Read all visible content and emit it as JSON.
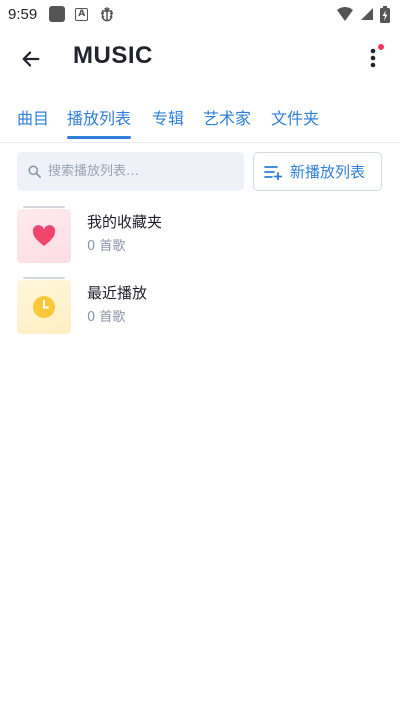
{
  "status_bar": {
    "time": "9:59",
    "icons": [
      "app-square-icon",
      "a-box-icon",
      "bug-icon",
      "wifi-icon",
      "signal-icon",
      "battery-charging-icon"
    ]
  },
  "app_bar": {
    "title": "MUSIC",
    "back_icon": "arrow-left-icon",
    "menu_icon": "more-vert-icon",
    "notification_dot_color": "#f0365a"
  },
  "tabs": [
    {
      "label": "曲目",
      "active": false
    },
    {
      "label": "播放列表",
      "active": true
    },
    {
      "label": "专辑",
      "active": false
    },
    {
      "label": "艺术家",
      "active": false
    },
    {
      "label": "文件夹",
      "active": false
    }
  ],
  "search": {
    "placeholder": "搜索播放列表…",
    "value": ""
  },
  "new_playlist_button": {
    "label": "新播放列表",
    "icon": "playlist-add-icon"
  },
  "playlists": [
    {
      "title": "我的收藏夹",
      "subtitle": "0 首歌",
      "icon": "heart-icon",
      "icon_color": "#f0466e"
    },
    {
      "title": "最近播放",
      "subtitle": "0 首歌",
      "icon": "clock-icon",
      "icon_color": "#f9c83a"
    }
  ],
  "colors": {
    "accent": "#2f7fd8",
    "search_bg": "#eef2f8",
    "secondary_text": "#8b95a5"
  }
}
